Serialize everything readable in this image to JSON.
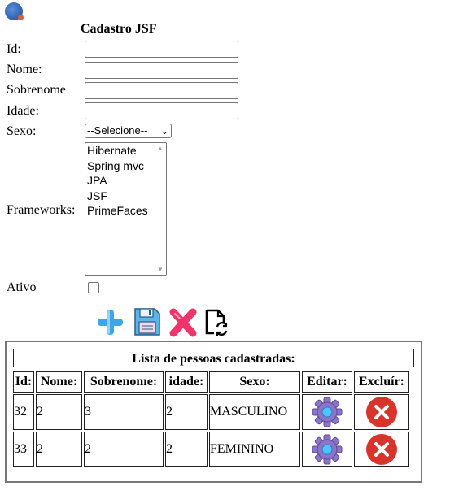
{
  "form": {
    "title": "Cadastro JSF",
    "labels": {
      "id": "Id:",
      "nome": "Nome:",
      "sobrenome": "Sobrenome",
      "idade": "Idade:",
      "sexo": "Sexo:",
      "frameworks": "Frameworks:",
      "ativo": "Ativo"
    },
    "values": {
      "id": "",
      "nome": "",
      "sobrenome": "",
      "idade": ""
    },
    "sexo_selected": "--Selecione--",
    "frameworks_options": [
      "Hibernate",
      "Spring mvc",
      "JPA",
      "JSF",
      "PrimeFaces"
    ],
    "ativo_checked": false
  },
  "toolbar": {
    "icons": [
      "add-icon",
      "save-icon",
      "delete-icon",
      "refresh-document-icon"
    ],
    "colors": {
      "add": "#3ea6e6",
      "save": "#5bb6e8",
      "delete": "#f0346a",
      "refresh": "#000000"
    }
  },
  "table": {
    "caption": "Lista de pessoas cadastradas:",
    "headers": [
      "Id:",
      "Nome:",
      "Sobrenome:",
      "idade:",
      "Sexo:",
      "Editar:",
      "Excluír:"
    ],
    "rows": [
      {
        "id": "32",
        "nome": "2",
        "sobrenome": "3",
        "idade": "2",
        "sexo": "MASCULINO",
        "edit_icon": "gear-icon",
        "delete_icon": "delete-circle-icon"
      },
      {
        "id": "33",
        "nome": "2",
        "sobrenome": "2",
        "idade": "2",
        "sexo": "FEMININO",
        "edit_icon": "gear-icon",
        "delete_icon": "delete-circle-icon"
      }
    ],
    "colors": {
      "gear": "#8c74c8",
      "gear_center": "#4fc3ff",
      "delete_circle": "#d9342b"
    }
  }
}
